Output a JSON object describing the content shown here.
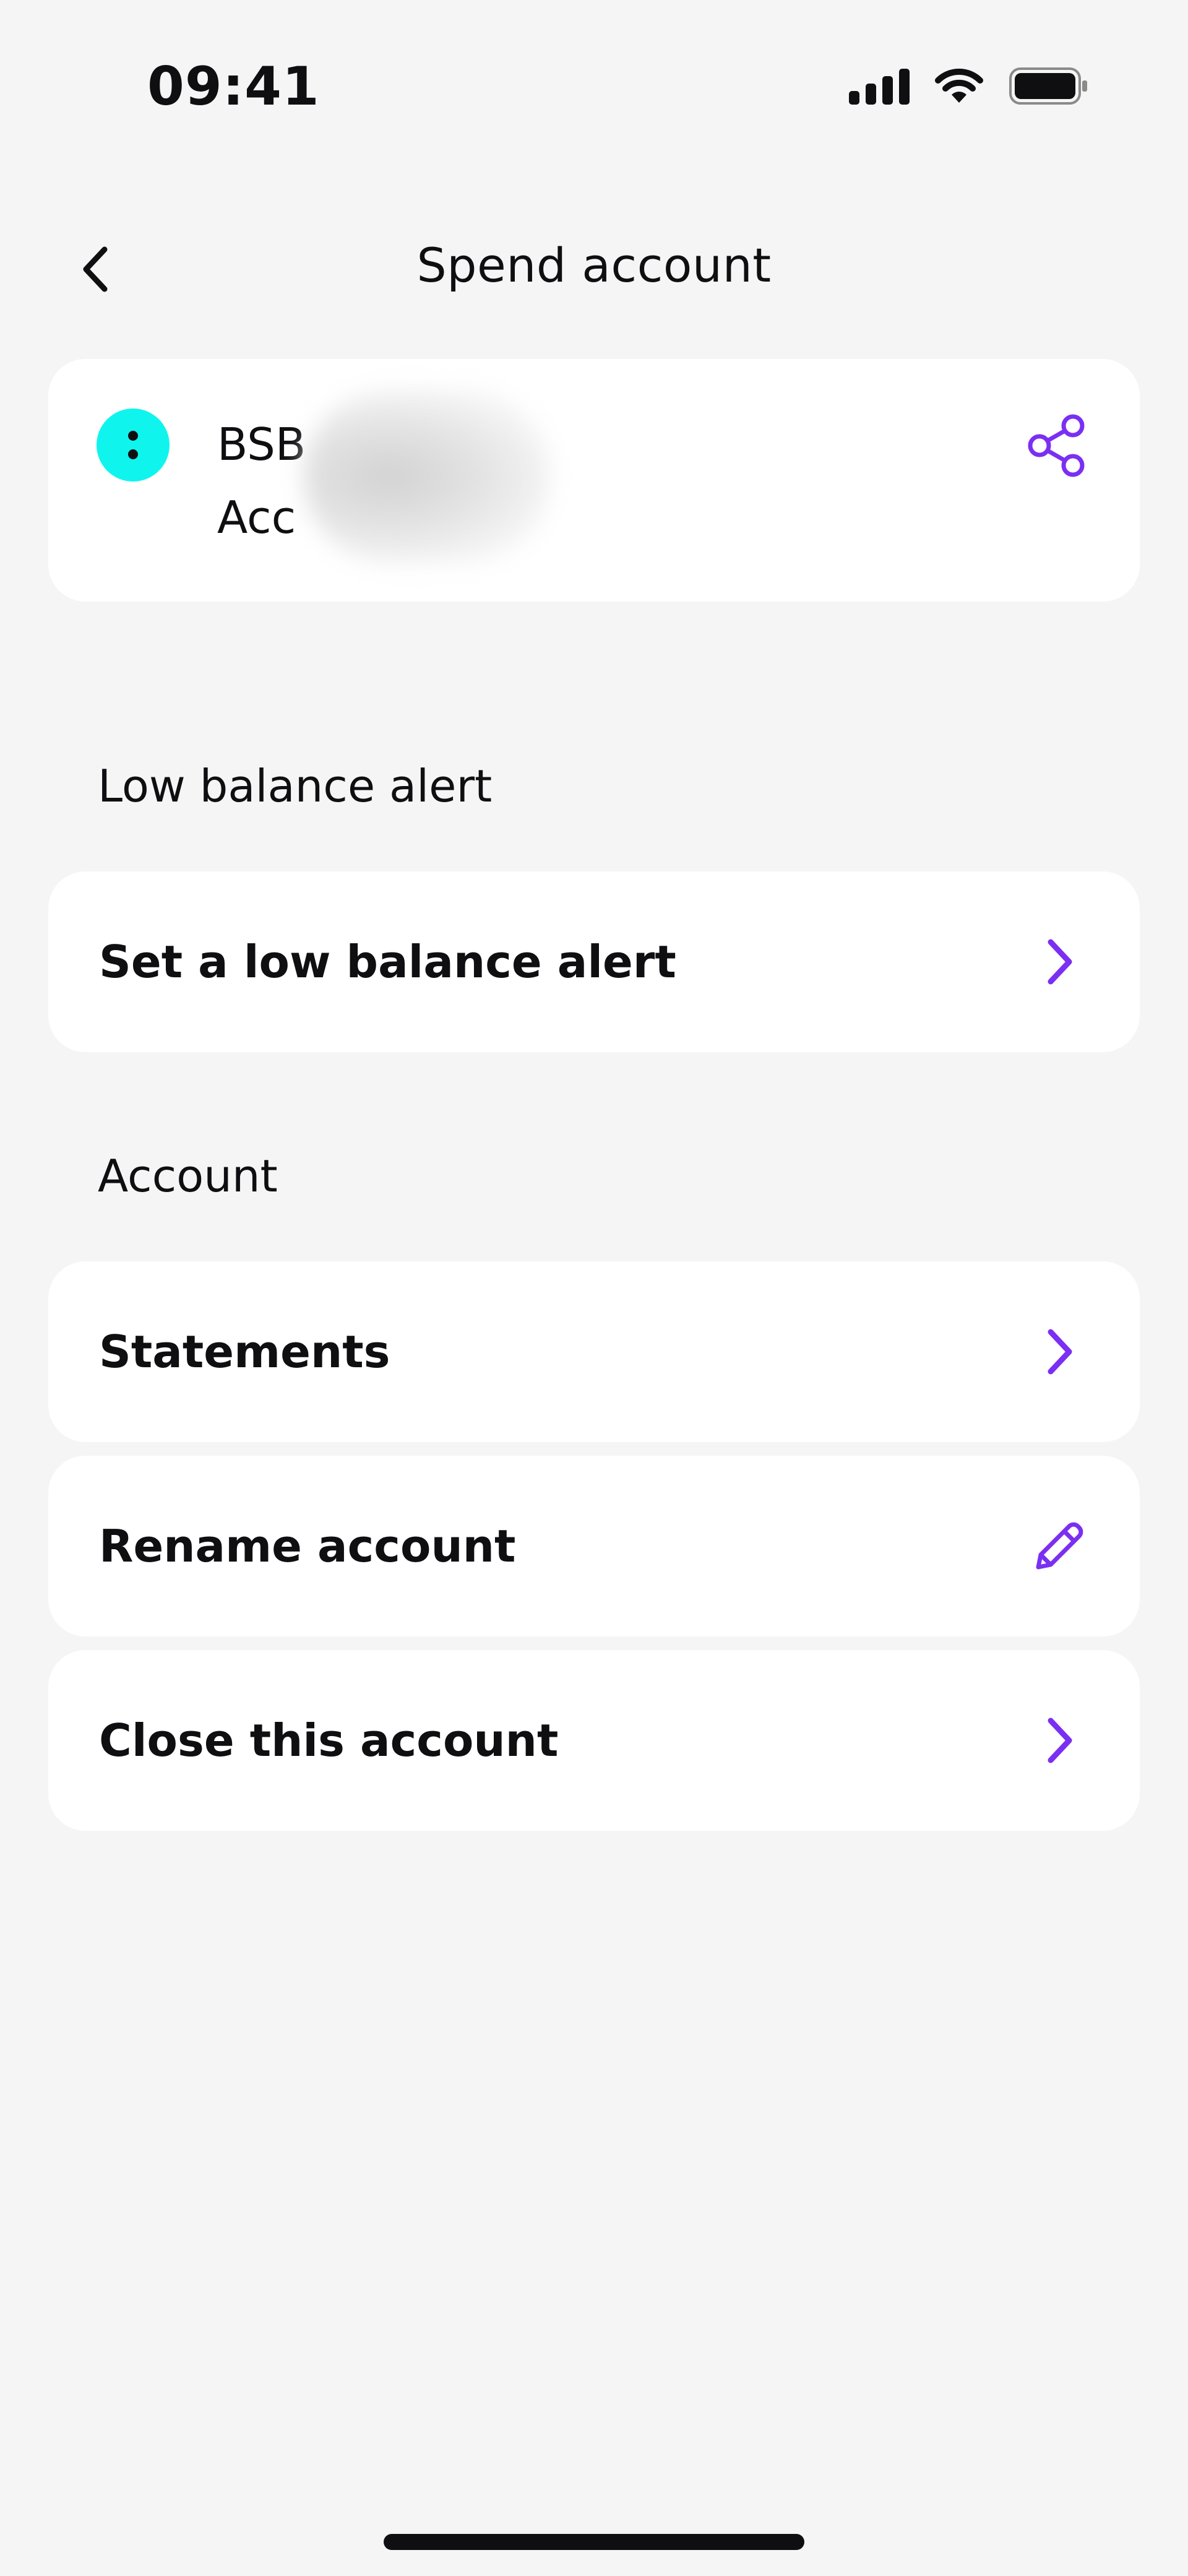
{
  "status_bar": {
    "time": "09:41",
    "icons": [
      "signal-icon",
      "wifi-icon",
      "battery-icon"
    ]
  },
  "header": {
    "title": "Spend account",
    "back_icon": "chevron-left-icon"
  },
  "account_card": {
    "bsb_label": "BSB",
    "account_label": "Acc",
    "avatar_color": "#0ff5ee",
    "share_icon": "share-icon"
  },
  "sections": {
    "low_balance_title": "Low balance alert",
    "account_title": "Account"
  },
  "rows": {
    "low_balance": "Set a low balance alert",
    "statements": "Statements",
    "rename": "Rename account",
    "close": "Close this account"
  },
  "colors": {
    "accent": "#7b2ff2",
    "background": "#f5f5f5",
    "card": "#ffffff",
    "text": "#0f0f12"
  }
}
